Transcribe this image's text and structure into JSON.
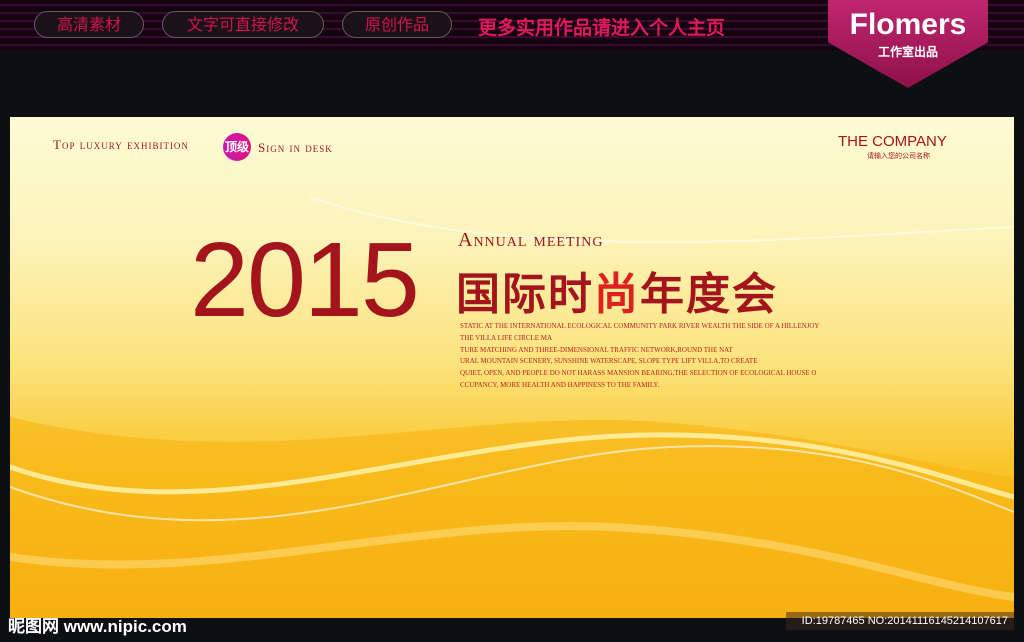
{
  "topbar": {
    "pills": [
      "高清素材",
      "文字可直接修改",
      "原创作品"
    ],
    "promo": "更多实用作品请进入个人主页"
  },
  "badge": {
    "brand": "Flomers",
    "sub": "工作室出品"
  },
  "poster": {
    "tagline": "Top luxury exhibition",
    "dingji": "顶级",
    "sign": "Sign in desk",
    "company": "THE COMPANY",
    "company_sub": "请输入您的公司名称",
    "year": "2015",
    "annual": "Annual meeting",
    "cn_title_a": "国际时",
    "cn_title_b": "尚",
    "cn_title_c": "年度会",
    "body": [
      "STATIC AT THE INTERNATIONAL ECOLOGICAL COMMUNITY PARK RIVER WEALTH THE SIDE OF A HILLENJOY",
      "THE VILLA LIFE CIRCLE MA",
      "TURE MATCHING AND THREE-DIMENSIONAL TRAFFIC NETWORK,ROUND THE NAT",
      "URAL MOUNTAIN SCENERY, SUNSHINE WATERSCAPE, SLOPE TYPE LIFT VILLA,TO CREATE",
      "QUIET, OPEN, AND PEOPLE DO NOT HARASS MANSION BEARING,THE SELECTION OF ECOLOGICAL HOUSE O",
      "CCUPANCY, MORE HEALTH AND HAPPINESS TO THE FAMILY."
    ]
  },
  "watermark": {
    "left": "昵图网 www.nipic.com",
    "right": "ID:19787465 NO:20141116145214107617"
  }
}
